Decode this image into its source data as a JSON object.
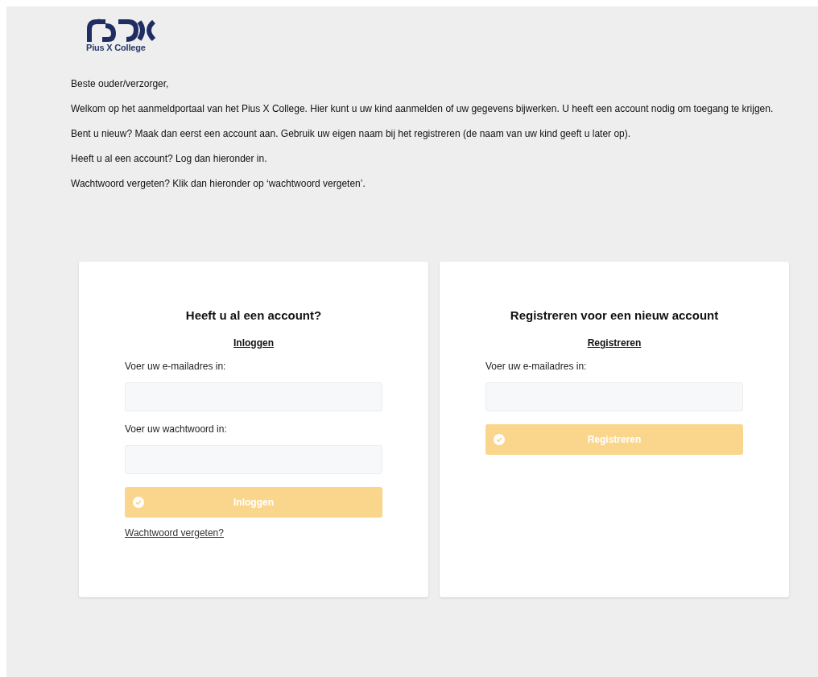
{
  "logo": {
    "name": "Pius X College"
  },
  "intro": [
    "Beste ouder/verzorger,",
    "Welkom op het aanmeldportaal van het Pius X College. Hier kunt u uw kind aanmelden of uw gegevens bijwerken. U heeft een account nodig om toegang te krijgen.",
    "Bent u nieuw? Maak dan eerst een account aan. Gebruik uw eigen naam bij het registreren (de naam van uw kind geeft u later op).",
    "Heeft u al een account? Log dan hieronder in.",
    "Wachtwoord vergeten? Klik dan hieronder op ‘wachtwoord vergeten’."
  ],
  "cards": [
    {
      "title": "Heeft u al een account?",
      "link": "Inloggen",
      "fields": [
        {
          "label": "Voer uw e-mailadres in:"
        },
        {
          "label": "Voer uw wachtwoord in:"
        }
      ],
      "button": {
        "label": "Inloggen",
        "disabled": true
      },
      "footer_link": "Wachtwoord vergeten?"
    },
    {
      "title": "Registreren voor een nieuw account",
      "link": "Registreren",
      "fields": [
        {
          "label": "Voer uw e-mailadres in:"
        }
      ],
      "button": {
        "label": "Registreren",
        "disabled": true
      }
    }
  ]
}
